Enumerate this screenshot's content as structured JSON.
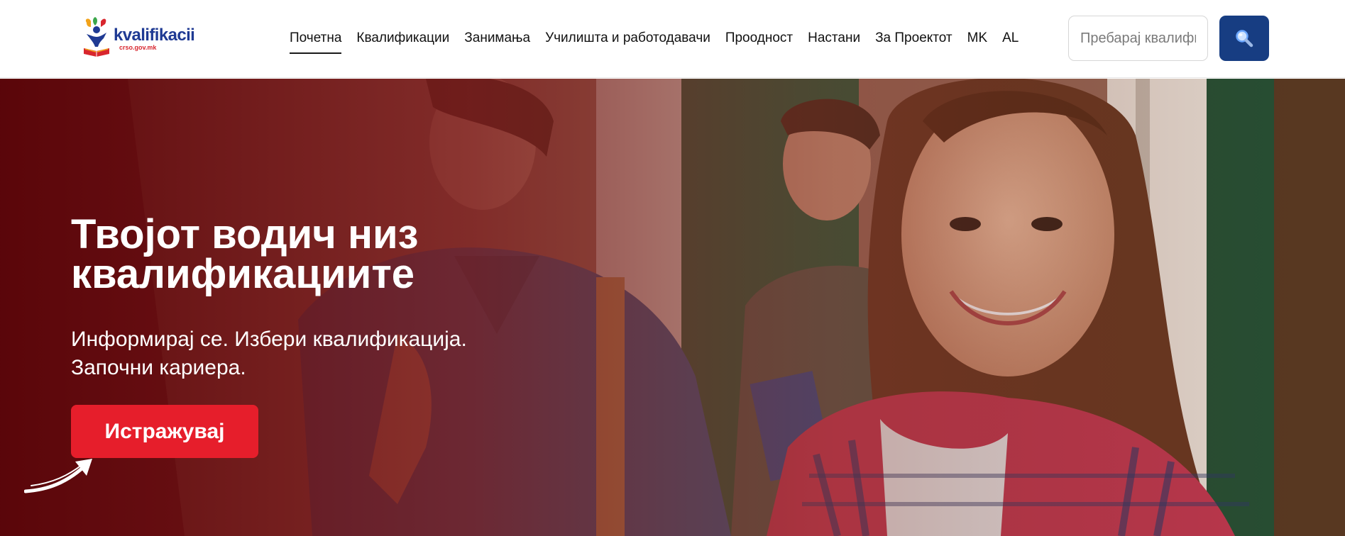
{
  "header": {
    "logo": {
      "name": "kvalifikacii",
      "domain": "crso.gov.mk"
    },
    "nav": [
      {
        "label": "Почетна",
        "active": true
      },
      {
        "label": "Квалификации"
      },
      {
        "label": "Занимања"
      },
      {
        "label": "Училишта и работодавачи"
      },
      {
        "label": "Проодност"
      },
      {
        "label": "Настани"
      },
      {
        "label": "За Проектот"
      },
      {
        "label": "MK"
      },
      {
        "label": "AL"
      }
    ],
    "search": {
      "placeholder": "Пребарај квалификации",
      "value": "",
      "button_icon": "search-icon"
    }
  },
  "hero": {
    "title_line1": "Твојот водич низ",
    "title_line2": "квалификациите",
    "subtitle_line1": "Информирај се. Избери квалификација.",
    "subtitle_line2": "Започни кариера.",
    "cta_label": "Истражувај",
    "decorative_icon": "curved-arrow-icon"
  },
  "colors": {
    "brand_blue": "#1f3a93",
    "search_button": "#173d82",
    "cta_red": "#e61e2b",
    "hero_overlay": "#6b0d12"
  }
}
